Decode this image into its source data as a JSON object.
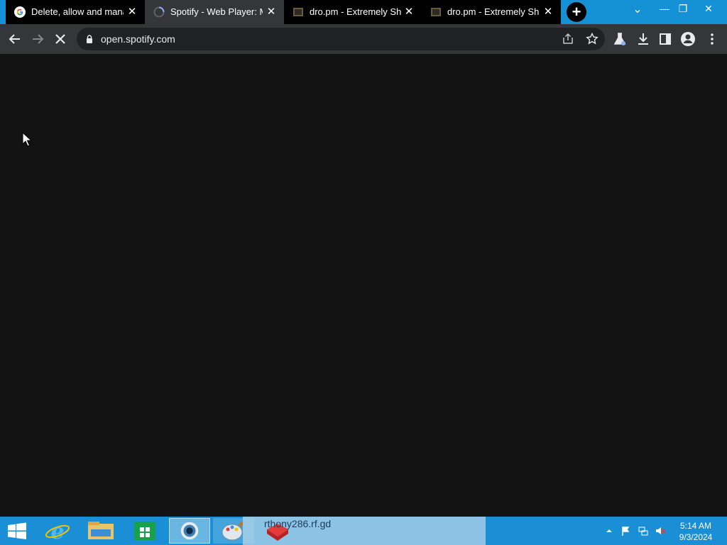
{
  "browser": {
    "tabs": [
      {
        "title": "Delete, allow and mana",
        "favicon": "google-g-icon",
        "active": false
      },
      {
        "title": "Spotify - Web Player: M",
        "favicon": "loading-globe-icon",
        "active": true
      },
      {
        "title": "dro.pm - Extremely Sho",
        "favicon": "dro-pm-icon",
        "active": false
      },
      {
        "title": "dro.pm - Extremely Sho",
        "favicon": "dro-pm-icon",
        "active": false
      }
    ],
    "close_glyph": "✕",
    "new_tab_glyph": "+",
    "window_controls": {
      "minimize": "—",
      "restore": "❐",
      "close": "✕",
      "tab_search": "⌄"
    },
    "url": "open.spotify.com"
  },
  "page": {
    "background": "#131313",
    "state": "loading"
  },
  "taskbar": {
    "overlay_text": "rthony286.rf.gd",
    "clock": {
      "time": "5:14 AM",
      "date": "9/3/2024"
    },
    "apps": [
      "start-icon",
      "internet-explorer-icon",
      "file-explorer-icon",
      "store-icon",
      "chrome-icon",
      "paint-icon",
      "app-icon"
    ]
  },
  "colors": {
    "titlebar": "#1592d6",
    "toolbar": "#35363a",
    "omnibox": "#202124",
    "taskbar": "#1a8fd5"
  }
}
